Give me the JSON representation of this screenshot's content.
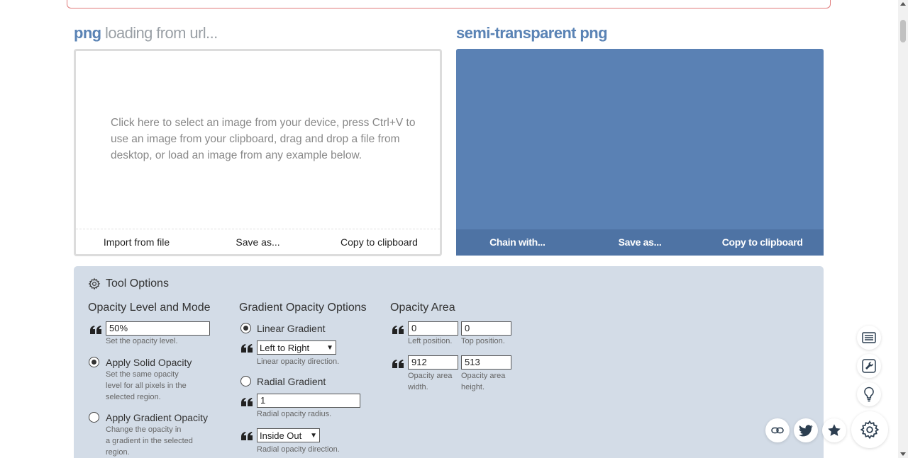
{
  "input_panel": {
    "title_format": "png",
    "title_rest": "loading from url...",
    "placeholder": "Click here to select an image from your device, press Ctrl+V to use an image from your clipboard, drag and drop a file from desktop, or load an image from any example below.",
    "actions": [
      "Import from file",
      "Save as...",
      "Copy to clipboard"
    ]
  },
  "output_panel": {
    "title": "semi-transparent png",
    "actions": [
      "Chain with...",
      "Save as...",
      "Copy to clipboard"
    ],
    "bg_color": "#5a81b4"
  },
  "tool_options": {
    "header": "Tool Options",
    "opacity_level": {
      "title": "Opacity Level and Mode",
      "level_value": "50%",
      "level_help": "Set the opacity level.",
      "solid_label": "Apply Solid Opacity",
      "solid_help": [
        "Set the same opacity",
        "level for all pixels in the",
        "selected region."
      ],
      "gradient_label": "Apply Gradient Opacity",
      "gradient_help": [
        "Change the opacity in",
        "a gradient in the selected",
        "region."
      ],
      "selected_mode": "Apply Solid Opacity"
    },
    "gradient_options": {
      "title": "Gradient Opacity Options",
      "linear_label": "Linear Gradient",
      "linear_direction": "Left to Right",
      "linear_help": "Linear opacity direction.",
      "radial_label": "Radial Gradient",
      "radial_radius": "1",
      "radial_radius_help": "Radial opacity radius.",
      "radial_direction": "Inside Out",
      "radial_direction_help": "Radial opacity direction.",
      "selected_type": "Linear Gradient"
    },
    "opacity_area": {
      "title": "Opacity Area",
      "left": "0",
      "left_help": "Left position.",
      "top": "0",
      "top_help": "Top position.",
      "width": "912",
      "width_help": [
        "Opacity area",
        "width."
      ],
      "height": "513",
      "height_help": [
        "Opacity area",
        "height."
      ]
    }
  },
  "floating_buttons": [
    "list-icon",
    "wrench-icon",
    "lightbulb-icon",
    "link-icon",
    "twitter-icon",
    "star-icon",
    "gear-icon"
  ]
}
